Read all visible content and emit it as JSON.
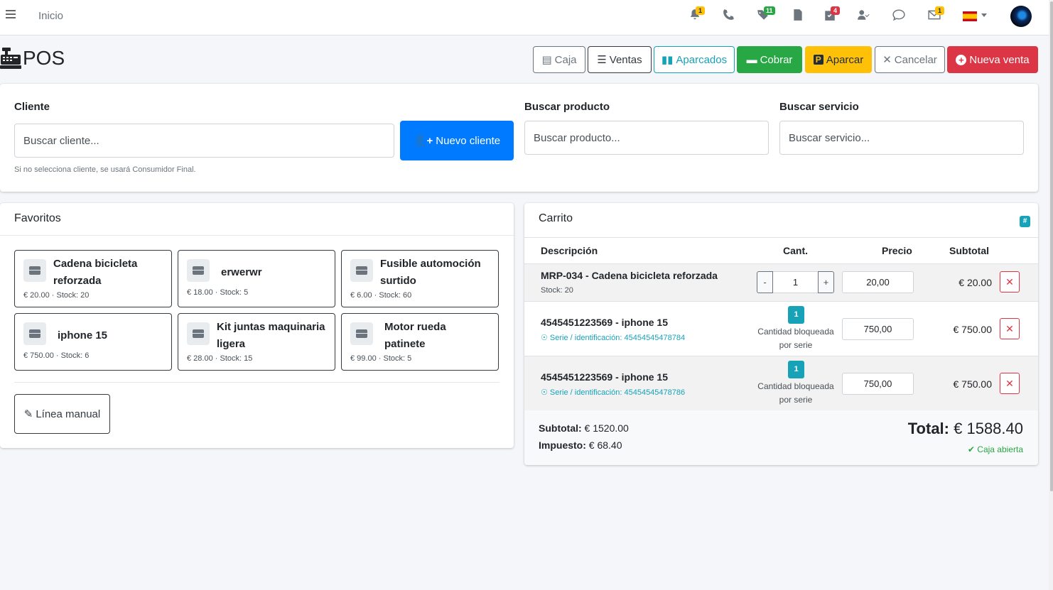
{
  "nav": {
    "home": "Inicio",
    "badges": {
      "notifications": "1",
      "tags": "11",
      "tasks": "4",
      "messages": "1"
    }
  },
  "header": {
    "title": "POS",
    "buttons": {
      "caja": "Caja",
      "ventas": "Ventas",
      "aparcados": "Aparcados",
      "cobrar": "Cobrar",
      "aparcar": "Aparcar",
      "cancelar": "Cancelar",
      "nueva_venta": "Nueva venta"
    }
  },
  "search": {
    "cliente_label": "Cliente",
    "cliente_placeholder": "Buscar cliente...",
    "nuevo_cliente": "Nuevo cliente",
    "cliente_hint": "Si no selecciona cliente, se usará Consumidor Final.",
    "producto_label": "Buscar producto",
    "producto_placeholder": "Buscar producto...",
    "servicio_label": "Buscar servicio",
    "servicio_placeholder": "Buscar servicio..."
  },
  "favorites": {
    "title": "Favoritos",
    "items": [
      {
        "name_1": "Cadena bicicleta",
        "name_2": "reforzada",
        "meta": "€ 20.00 · Stock: 20"
      },
      {
        "name_1": "erwerwr",
        "name_2": "",
        "meta": "€ 18.00 · Stock: 5"
      },
      {
        "name_1": "Fusible automoción",
        "name_2": "surtido",
        "meta": "€ 6.00 · Stock: 60"
      },
      {
        "name_1": "iphone 15",
        "name_2": "",
        "meta": "€ 750.00 · Stock: 6"
      },
      {
        "name_1": "Kit juntas maquinaria",
        "name_2": "ligera",
        "meta": "€ 28.00 · Stock: 15"
      },
      {
        "name_1": "Motor rueda",
        "name_2": "patinete",
        "meta": "€ 99.00 · Stock: 5"
      }
    ],
    "manual_line": "Línea manual"
  },
  "cart": {
    "title": "Carrito",
    "hash": "#",
    "columns": {
      "desc": "Descripción",
      "qty": "Cant.",
      "price": "Precio",
      "subtotal": "Subtotal"
    },
    "rows": [
      {
        "desc": "MRP-034 - Cadena bicicleta reforzada",
        "stock": "Stock: 20",
        "qty": "1",
        "price": "20,00",
        "subtotal": "€ 20.00"
      },
      {
        "desc": "4545451223569 - iphone 15",
        "serial": "Serie / identificación: 45454545478784",
        "qty_badge": "1",
        "locked_1": "Cantidad bloqueada",
        "locked_2": "por serie",
        "price": "750,00",
        "subtotal": "€ 750.00"
      },
      {
        "desc": "4545451223569 - iphone 15",
        "serial": "Serie / identificación: 45454545478786",
        "qty_badge": "1",
        "locked_1": "Cantidad bloqueada",
        "locked_2": "por serie",
        "price": "750,00",
        "subtotal": "€ 750.00"
      }
    ],
    "qty_minus": "-",
    "qty_plus": "+",
    "remove": "✕",
    "subtotal_label": "Subtotal:",
    "subtotal_value": "€ 1520.00",
    "tax_label": "Impuesto:",
    "tax_value": "€ 68.40",
    "total_label": "Total:",
    "total_value": "€ 1588.40",
    "status": "Caja abierta"
  },
  "colors": {
    "primary": "#007bff",
    "success": "#28a745",
    "warning": "#ffc107",
    "danger": "#dc3545",
    "info": "#17a2b8"
  }
}
